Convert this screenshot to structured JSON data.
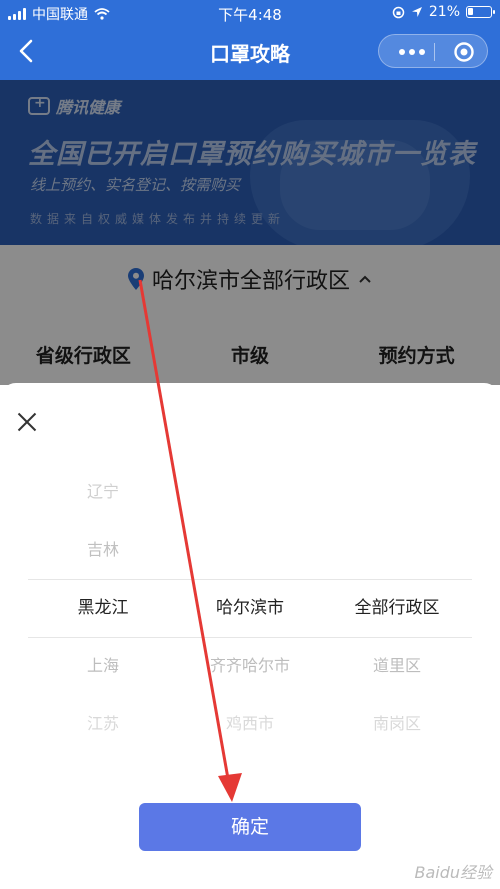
{
  "status_bar": {
    "carrier": "中国联通",
    "time": "下午4:48",
    "battery": "21%"
  },
  "nav": {
    "title": "口罩攻略"
  },
  "banner": {
    "brand": "腾讯健康",
    "title": "全国已开启口罩预约购买城市一览表",
    "subtitle": "线上预约、实名登记、按需购买",
    "note": "数据来自权威媒体发布并持续更新"
  },
  "region": {
    "label": "哈尔滨市全部行政区"
  },
  "table_headers": [
    "省级行政区",
    "市级",
    "预约方式"
  ],
  "picker": {
    "province": [
      "",
      "辽宁",
      "吉林",
      "黑龙江",
      "上海",
      "江苏"
    ],
    "city": [
      "",
      "",
      "",
      "哈尔滨市",
      "齐齐哈尔市",
      "鸡西市"
    ],
    "district": [
      "",
      "",
      "",
      "全部行政区",
      "道里区",
      "南岗区"
    ]
  },
  "confirm_label": "确定",
  "watermark": "Baidu经验",
  "colors": {
    "nav_blue": "#2f6fd8",
    "confirm_blue": "#5b78e6",
    "arrow_red": "#e53935"
  }
}
